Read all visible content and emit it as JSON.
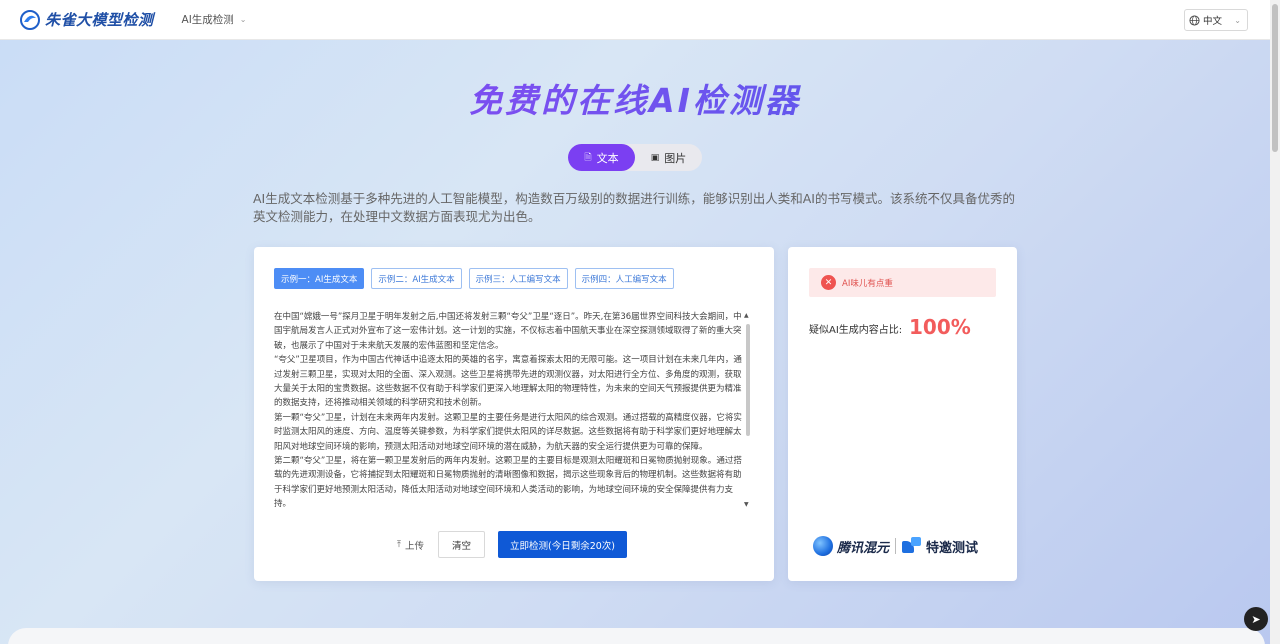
{
  "header": {
    "brand": "朱雀大模型检测",
    "nav_item": "AI生成检测",
    "language": "中文"
  },
  "hero": {
    "title": "免费的在线AI检测器",
    "tabs": [
      {
        "label": "文本",
        "icon": "document-icon",
        "active": true
      },
      {
        "label": "图片",
        "icon": "image-icon",
        "active": false
      }
    ],
    "description": "AI生成文本检测基于多种先进的人工智能模型，构造数百万级别的数据进行训练，能够识别出人类和AI的书写模式。该系统不仅具备优秀的英文检测能力，在处理中文数据方面表现尤为出色。"
  },
  "detector": {
    "examples": [
      {
        "label": "示例一：AI生成文本",
        "active": true
      },
      {
        "label": "示例二：AI生成文本",
        "active": false
      },
      {
        "label": "示例三：人工编写文本",
        "active": false
      },
      {
        "label": "示例四：人工编写文本",
        "active": false
      }
    ],
    "paragraphs": [
      "在中国“嫦娥一号”探月卫星于明年发射之后,中国还将发射三颗“夸父”卫星“逐日”。昨天,在第36届世界空间科技大会期间，中国宇航局发言人正式对外宣布了这一宏伟计划。这一计划的实施，不仅标志着中国航天事业在深空探测领域取得了新的重大突破，也展示了中国对于未来航天发展的宏伟蓝图和坚定信念。",
      "“夸父”卫星项目，作为中国古代神话中追逐太阳的英雄的名字，寓意着探索太阳的无限可能。这一项目计划在未来几年内，通过发射三颗卫星，实现对太阳的全面、深入观测。这些卫星将携带先进的观测仪器，对太阳进行全方位、多角度的观测，获取大量关于太阳的宝贵数据。这些数据不仅有助于科学家们更深入地理解太阳的物理特性，为未来的空间天气预报提供更为精准的数据支持，还将推动相关领域的科学研究和技术创新。",
      "第一颗“夸父”卫星，计划在未来两年内发射。这颗卫星的主要任务是进行太阳风的综合观测。通过搭载的高精度仪器，它将实时监测太阳风的速度、方向、温度等关键参数，为科学家们提供太阳风的详尽数据。这些数据将有助于科学家们更好地理解太阳风对地球空间环境的影响，预测太阳活动对地球空间环境的潜在威胁，为航天器的安全运行提供更为可靠的保障。",
      "第二颗“夸父”卫星，将在第一颗卫星发射后的两年内发射。这颗卫星的主要目标是观测太阳耀斑和日冕物质抛射现象。通过搭载的先进观测设备，它将捕捉到太阳耀斑和日冕物质抛射的清晰图像和数据，揭示这些现象背后的物理机制。这些数据将有助于科学家们更好地预测太阳活动，降低太阳活动对地球空间环境和人类活动的影响，为地球空间环境的安全保障提供有力支持。"
    ],
    "upload_label": "上传",
    "clear_label": "清空",
    "detect_label": "立即检测(今日剩余20次)"
  },
  "result": {
    "alert": "AI味儿有点重",
    "ratio_label": "疑似AI生成内容占比:",
    "ratio_value": "100%",
    "partner_name": "腾讯混元",
    "partner_tag": "特邀测试"
  }
}
